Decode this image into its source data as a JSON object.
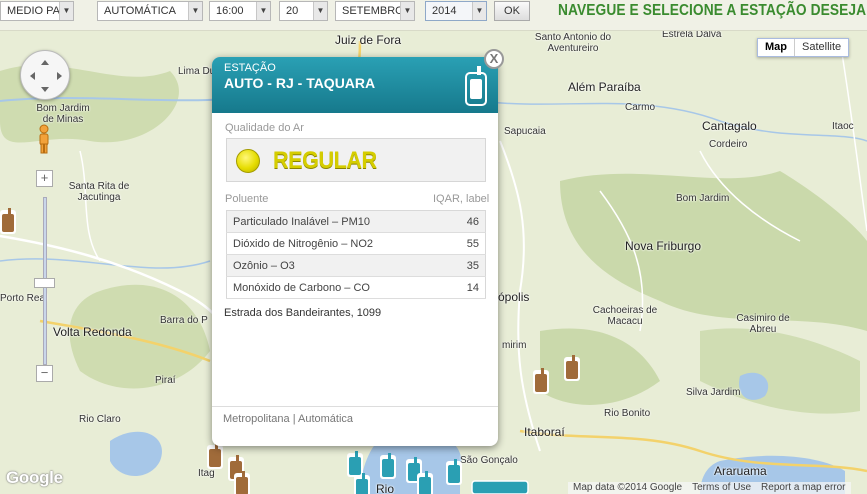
{
  "filters": {
    "region": "MEDIO PARAI",
    "type": "AUTOMÁTICA",
    "hour": "16:00",
    "day": "20",
    "month": "SETEMBRO",
    "year": "2014",
    "ok_label": "OK"
  },
  "headline": "NAVEGUE E SELECIONE A ESTAÇÃO DESEJADA",
  "map": {
    "map_type_buttons": [
      "Map",
      "Satellite"
    ],
    "active_map_type": "Map",
    "cities": {
      "juiz_de_fora": "Juiz de Fora",
      "santo_antonio": "Santo Antonio do Aventureiro",
      "estrela_dalva": "Estrela Dalva",
      "lima_du": "Lima Du",
      "bom_jardim_minas": "Bom Jardim de Minas",
      "alem_paraiba": "Além Paraíba",
      "carmo": "Carmo",
      "sapucaia": "Sapucaia",
      "cantagalo": "Cantagalo",
      "cordeiro": "Cordeiro",
      "itaoc": "Itaoc",
      "santa_rita": "Santa Rita de Jacutinga",
      "bom_jardim": "Bom Jardim",
      "nova_friburgo": "Nova Friburgo",
      "porto_real": "Porto Real",
      "petropolis": "ópolis",
      "volta_redonda": "Volta Redonda",
      "barra_do_p": "Barra do P",
      "cachoeiras": "Cachoeiras de Macacu",
      "casimiro": "Casimiro de Abreu",
      "mirim": "mirim",
      "pirai": "Piraí",
      "silva_jardim": "Silva Jardim",
      "rio_claro": "Rio Claro",
      "rio_bonito": "Rio Bonito",
      "itaborai": "Itaboraí",
      "itag": "Itag",
      "sao_goncalo": "São Gonçalo",
      "araruama": "Araruama",
      "rio": "Rio"
    },
    "logo": "Google",
    "attribution": [
      "Map data ©2014 Google",
      "Terms of Use",
      "Report a map error"
    ]
  },
  "popup": {
    "kicker": "ESTAÇÃO",
    "title": "AUTO - RJ - TAQUARA",
    "close_label": "X",
    "quality_label": "Qualidade do Ar",
    "quality_value": "REGULAR",
    "quality_color": "#e6dd00",
    "col_pollutant": "Poluente",
    "col_iqar": "IQAR, label",
    "pollutants": [
      {
        "name": "Particulado Inalável – PM10",
        "value": "46"
      },
      {
        "name": "Dióxido de Nitrogênio – NO2",
        "value": "55"
      },
      {
        "name": "Ozônio – O3",
        "value": "35"
      },
      {
        "name": "Monóxido de Carbono – CO",
        "value": "14"
      }
    ],
    "address": "Estrada dos Bandeirantes, 1099",
    "footer": "Metropolitana | Automática"
  },
  "colors": {
    "header_teal": "#1a8ca0",
    "headline_green": "#3a8b2f",
    "station_brown": "#a06b3a",
    "station_teal": "#2a9fb3"
  }
}
